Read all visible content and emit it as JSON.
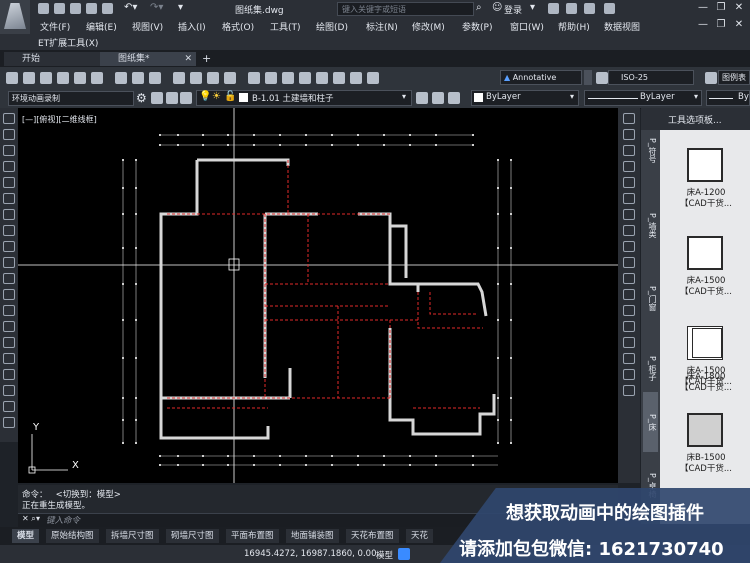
{
  "titlebar": {
    "filename": "图纸集.dwg",
    "search_placeholder": "键入关键字或短语",
    "login": "登录",
    "window_controls": [
      "—",
      "❐",
      "✕"
    ]
  },
  "menu": {
    "items": [
      "文件(F)",
      "编辑(E)",
      "视图(V)",
      "插入(I)",
      "格式(O)",
      "工具(T)",
      "绘图(D)",
      "标注(N)",
      "修改(M)",
      "参数(P)",
      "窗口(W)",
      "帮助(H)",
      "数据视图"
    ],
    "extension": "ET扩展工具(X)"
  },
  "doc_tabs": [
    "开始",
    "图纸集*"
  ],
  "toolbar": {
    "annotative": "Annotative",
    "dimstyle": "ISO-25",
    "table_label": "图例表",
    "workspace": "环境动画录制",
    "layer": "B-1.01 土建墙和柱子",
    "color": "ByLayer",
    "linetype": "ByLayer",
    "lineweight": "By"
  },
  "canvas": {
    "view_label": "[—][俯视][二维线框]",
    "ucs_x": "X",
    "ucs_y": "Y"
  },
  "tool_palette": {
    "title": "工具选项板...",
    "side_tabs": [
      "P_符号",
      "P_墙类",
      "P_门窗",
      "P_柜子",
      "P_床",
      "P_卓椅"
    ],
    "tools": [
      {
        "name": "床A-1200",
        "sub": "【CAD干货..."
      },
      {
        "name": "床A-1500",
        "sub": "【CAD干货..."
      },
      {
        "name": "床A-1500",
        "sub": "【CAD干货..."
      },
      {
        "name": "床A-1800",
        "sub": "【CAD干货..."
      },
      {
        "name": "床B-1500",
        "sub": "【CAD干货..."
      }
    ]
  },
  "command": {
    "line1": "命令：   <切换到：模型>",
    "line2": "正在重生成模型。",
    "placeholder": "键入命令"
  },
  "layout_tabs": [
    "模型",
    "原始结构图",
    "拆墙尺寸图",
    "砌墙尺寸图",
    "平面布置图",
    "地面铺装图",
    "天花布置图",
    "天花"
  ],
  "status": {
    "coords": "16945.4272, 16987.1860, 0.00...",
    "mode": "模型"
  },
  "promo": {
    "line1": "想获取动画中的绘图插件",
    "line2": "请添加包包微信: 1621730740"
  },
  "colors": {
    "wall": "#d7d7d7",
    "red_dashed": "#e02a2a",
    "dim_line": "#cfcfcf",
    "canvas_bg": "#000000"
  }
}
